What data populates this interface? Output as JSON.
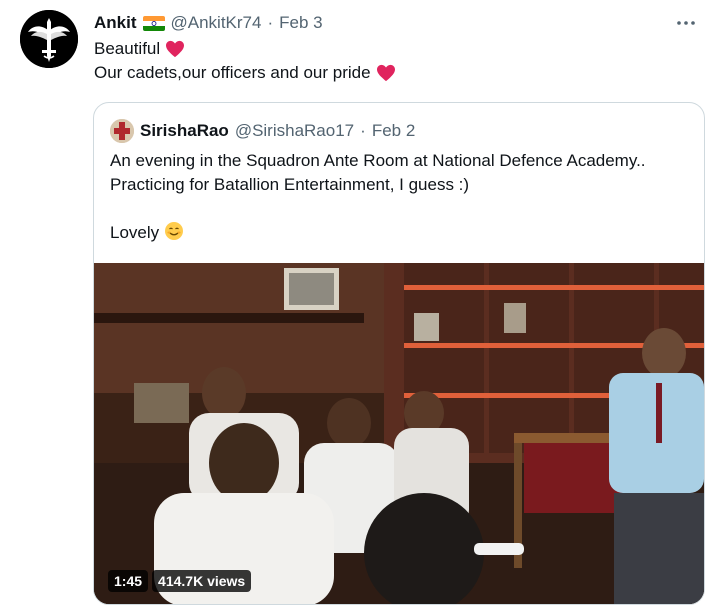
{
  "tweet": {
    "author_name": "Ankit",
    "author_handle": "@AnkitKr74",
    "separator": "·",
    "date": "Feb 3",
    "line1": "Beautiful",
    "line2": "Our cadets,our officers and our pride",
    "heart_icon": "red-heart-icon",
    "flag_icon": "india-flag-icon"
  },
  "quoted_tweet": {
    "author_name": "SirishaRao",
    "author_handle": "@SirishaRao17",
    "separator": "·",
    "date": "Feb 2",
    "line1": "An evening in the Squadron Ante Room at National Defence Academy..",
    "line2": "Practicing for Batallion Entertainment, I guess :)",
    "line3": "Lovely",
    "video": {
      "duration": "1:45",
      "views": "414.7K views"
    }
  },
  "colors": {
    "text": "#0f1419",
    "secondary": "#536471",
    "border": "#cfd9de",
    "heart": "#e0245e"
  }
}
